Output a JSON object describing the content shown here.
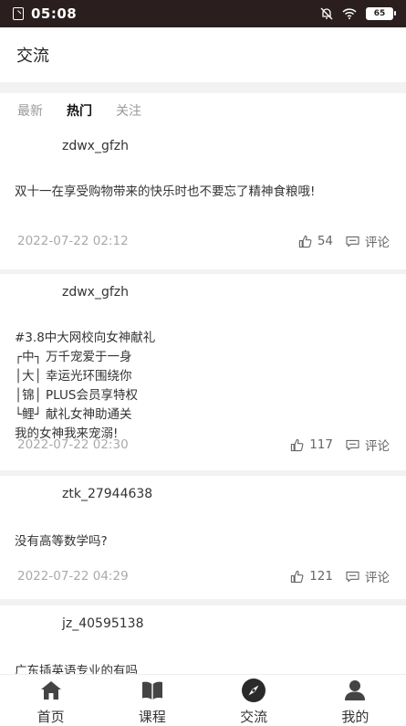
{
  "status_bar": {
    "time": "05:08",
    "battery": "65"
  },
  "header": {
    "title": "交流"
  },
  "tabs": [
    {
      "label": "最新",
      "active": false
    },
    {
      "label": "热门",
      "active": true
    },
    {
      "label": "关注",
      "active": false
    }
  ],
  "posts": [
    {
      "username": "zdwx_gfzh",
      "content": "双十一在享受购物带来的快乐时也不要忘了精神食粮哦!",
      "date": "2022-07-22 02:12",
      "likes": "54",
      "comment_label": "评论"
    },
    {
      "username": "zdwx_gfzh",
      "content": "#3.8中大网校向女神献礼\n┌中┐ 万千宠爱于一身\n│大│ 幸运光环围绕你\n│锦│ PLUS会员享特权\n└鲤┘ 献礼女神助通关\n我的女神我来宠溺!",
      "date": "2022-07-22 02:30",
      "likes": "117",
      "comment_label": "评论"
    },
    {
      "username": "ztk_27944638",
      "content": "没有高等数学吗?",
      "date": "2022-07-22 04:29",
      "likes": "121",
      "comment_label": "评论"
    },
    {
      "username": "jz_40595138",
      "content": "广东插英语专业的有吗",
      "date": "",
      "likes": "",
      "comment_label": ""
    }
  ],
  "bottom_nav": [
    {
      "label": "首页",
      "icon": "home-icon"
    },
    {
      "label": "课程",
      "icon": "book-icon"
    },
    {
      "label": "交流",
      "icon": "compass-icon"
    },
    {
      "label": "我的",
      "icon": "user-icon"
    }
  ],
  "colors": {
    "status_bar": "#2a1f1e",
    "background": "#f2f2f2",
    "text": "#333333",
    "muted": "#aaaaaa"
  }
}
